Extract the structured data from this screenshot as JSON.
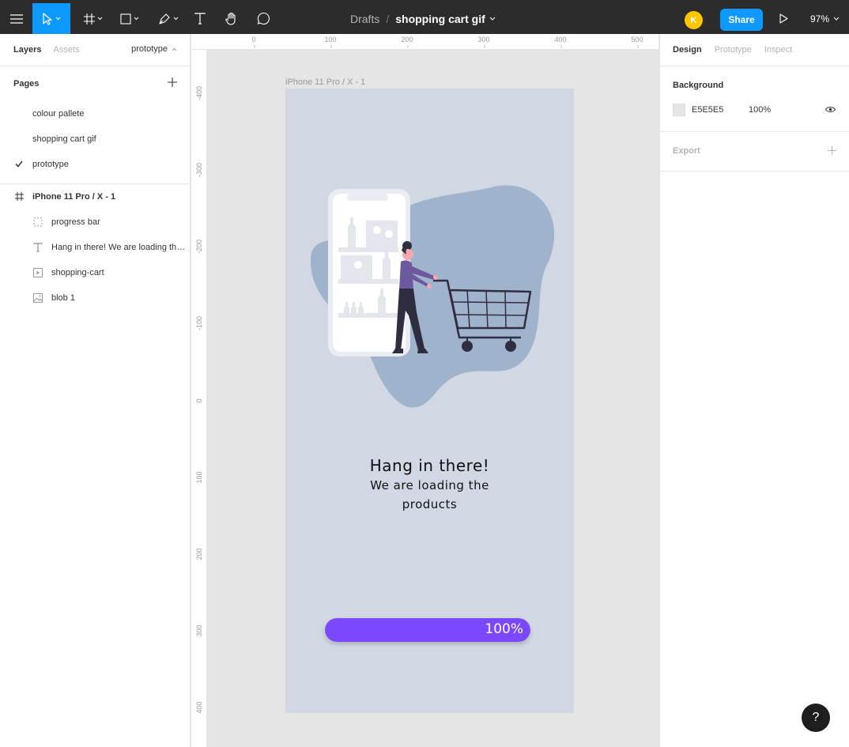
{
  "toolbar": {
    "breadcrumb_folder": "Drafts",
    "breadcrumb_sep": "/",
    "file_name": "shopping cart gif",
    "avatar_initial": "K",
    "share_label": "Share",
    "zoom": "97%"
  },
  "left_panel": {
    "tabs": [
      "Layers",
      "Assets"
    ],
    "current_page": "prototype",
    "pages_title": "Pages",
    "pages": [
      "colour pallete",
      "shopping cart gif",
      "prototype"
    ],
    "frame_layer": "iPhone 11 Pro / X - 1",
    "layers": [
      {
        "name": "progress bar",
        "icon": "component-dashed-icon"
      },
      {
        "name": "Hang in there! We are loading the products",
        "icon": "text-icon"
      },
      {
        "name": "shopping-cart",
        "icon": "gif-play-icon"
      },
      {
        "name": "blob 1",
        "icon": "image-icon"
      }
    ]
  },
  "rulers": {
    "top": [
      "0",
      "100",
      "200",
      "300",
      "400",
      "500"
    ],
    "left": [
      "-400",
      "-300",
      "-200",
      "-100",
      "0",
      "100",
      "200",
      "300",
      "400"
    ]
  },
  "canvas": {
    "frame_label": "iPhone 11 Pro / X - 1",
    "heading": "Hang in there!",
    "subtext_line1": "We are loading the",
    "subtext_line2": "products",
    "progress_value": 100,
    "progress_label": "100%",
    "colors": {
      "frame_bg": "#d1d8e3",
      "blob": "#a0b3cc",
      "progress": "#7b48ff",
      "phone": "#e9ecf2",
      "woman_top": "#6d5a9e",
      "dark": "#2f2e41",
      "skin": "#f4a8b0"
    }
  },
  "right_panel": {
    "tabs": [
      "Design",
      "Prototype",
      "Inspect"
    ],
    "background_title": "Background",
    "bg_hex": "E5E5E5",
    "bg_opacity": "100%",
    "export_title": "Export"
  },
  "help": "?"
}
